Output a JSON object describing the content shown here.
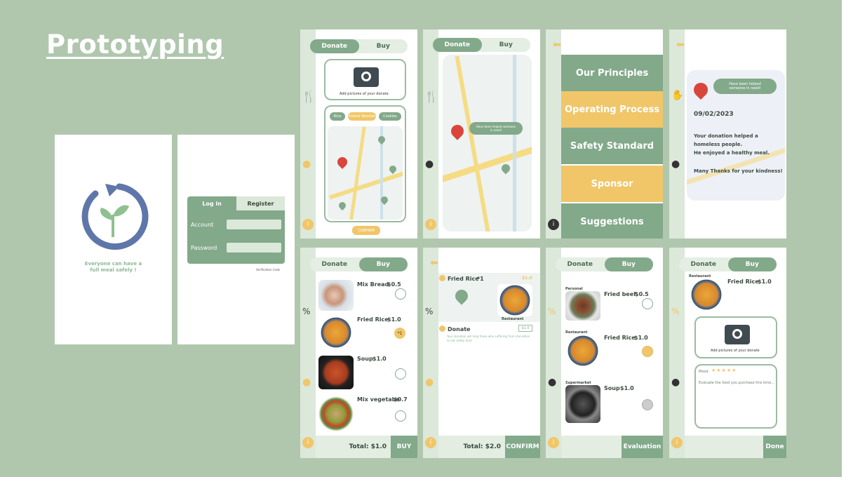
{
  "slide": {
    "title": "Prototyping",
    "bg": "#b0c7ad"
  },
  "splash": {
    "tagline_1": "Everyone can have a",
    "tagline_2": "full meal safely !"
  },
  "login": {
    "tab_login": "Log in",
    "tab_register": "Register",
    "account_label": "Account",
    "password_label": "Password",
    "verification": "Verification Code"
  },
  "donate_photo": {
    "tab_donate": "Donate",
    "tab_buy": "Buy",
    "photo_label": "Add pictures of your donate",
    "chips": [
      "Rice",
      "Instant Noodles",
      "Cookies"
    ],
    "confirm": "CONFIRM"
  },
  "map_screen": {
    "tab_donate": "Donate",
    "tab_buy": "Buy",
    "bubble": "Have been helped someone in need!"
  },
  "menu": {
    "items": [
      "Our Principles",
      "Operating Process",
      "Safety Standard",
      "Sponsor",
      "Suggestions"
    ]
  },
  "thanks": {
    "bubble": "Have been helped someone in need!",
    "date": "09/02/2023",
    "line1": "Your donation helped a",
    "line2": "homeless people.",
    "line3": "He enjoyed a healthy meal.",
    "line4": "Many Thanks for your kindness!"
  },
  "buy_list": {
    "tab_donate": "Donate",
    "tab_buy": "Buy",
    "items": [
      {
        "name": "Mix Bread",
        "price": "$0.5"
      },
      {
        "name": "Fried Rice",
        "price": "$1.0"
      },
      {
        "name": "Soup",
        "price": "$1.0"
      },
      {
        "name": "Mix vegetabe",
        "price": "$0.7"
      }
    ],
    "qty": "*1",
    "total": "Total: $1.0",
    "buy": "BUY"
  },
  "checkout": {
    "item": "Fried Rice",
    "qty": "*1",
    "price": "$1.0",
    "restaurant": "Restaurant",
    "donate": "Donate",
    "donate_price": "$1.0",
    "note": "Your donation will help those who suffering from starvation to eat safety food",
    "total": "Total: $2.0",
    "confirm": "CONFIRM"
  },
  "evaluate": {
    "tab_donate": "Donate",
    "tab_buy": "Buy",
    "items": [
      {
        "tag": "Personal",
        "name": "Fried beef",
        "price": "$0.5"
      },
      {
        "tag": "Restaurant",
        "name": "Fried Rice",
        "price": "$1.0"
      },
      {
        "tag": "Supermarket",
        "name": "Soup",
        "price": "$1.0"
      }
    ],
    "evaluation": "Evaluation"
  },
  "review": {
    "tab_donate": "Donate",
    "tab_buy": "Buy",
    "tag": "Restaurant",
    "item": "Fried Rice",
    "price": "$1.0",
    "photo_label": "Add pictures of your donate",
    "rating_label": "Mood",
    "stars": "★★★★★",
    "placeholder": "Evaluate the food you purchase this time...",
    "done": "Done"
  },
  "colors": {
    "green": "#82a98a",
    "yellow": "#f0c669",
    "rail": "#dbe8da"
  }
}
